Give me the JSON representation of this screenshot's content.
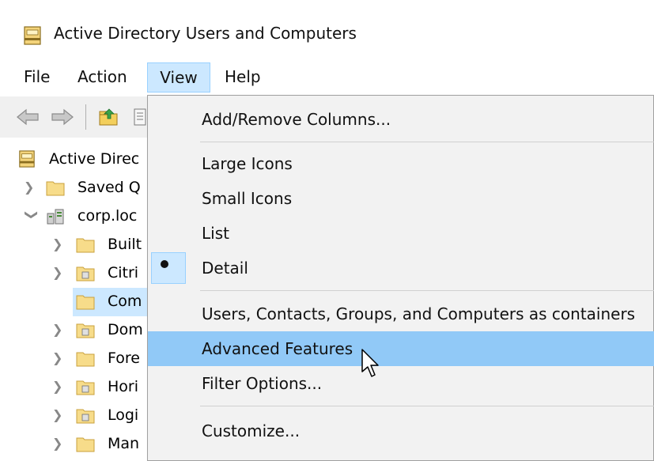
{
  "window": {
    "title": "Active Directory Users and Computers"
  },
  "menubar": {
    "items": [
      {
        "label": "File"
      },
      {
        "label": "Action"
      },
      {
        "label": "View"
      },
      {
        "label": "Help"
      }
    ],
    "active": "View"
  },
  "toolbar": {
    "icons": [
      "back-arrow-icon",
      "forward-arrow-icon",
      "up-folder-icon",
      "properties-icon"
    ]
  },
  "tree": {
    "items": [
      {
        "label": "Active Direc",
        "expander": "none",
        "icon": "ad-root-icon"
      },
      {
        "label": "Saved Q",
        "expander": "collapsed",
        "icon": "folder-icon"
      },
      {
        "label": "corp.loc",
        "expander": "expanded",
        "icon": "domain-icon"
      },
      {
        "label": "Built",
        "expander": "collapsed",
        "icon": "folder-icon"
      },
      {
        "label": "Citri",
        "expander": "collapsed",
        "icon": "ou-folder-icon"
      },
      {
        "label": "Com",
        "expander": "none",
        "icon": "folder-icon",
        "selected": true
      },
      {
        "label": "Dom",
        "expander": "collapsed",
        "icon": "ou-folder-icon"
      },
      {
        "label": "Fore",
        "expander": "collapsed",
        "icon": "folder-icon"
      },
      {
        "label": "Hori",
        "expander": "collapsed",
        "icon": "ou-folder-icon"
      },
      {
        "label": "Logi",
        "expander": "collapsed",
        "icon": "ou-folder-icon"
      },
      {
        "label": "Man",
        "expander": "collapsed",
        "icon": "folder-icon"
      }
    ]
  },
  "view_menu": {
    "items": [
      {
        "label": "Add/Remove Columns..."
      },
      {
        "label": "Large Icons"
      },
      {
        "label": "Small Icons"
      },
      {
        "label": "List"
      },
      {
        "label": "Detail",
        "checked": true
      },
      {
        "label": "Users, Contacts, Groups, and Computers as containers"
      },
      {
        "label": "Advanced Features",
        "highlighted": true
      },
      {
        "label": "Filter Options..."
      },
      {
        "label": "Customize..."
      }
    ]
  },
  "colors": {
    "menu_active_bg": "#cce8ff",
    "menu_highlight_bg": "#91c9f7",
    "folder_yellow": "#f5d67a"
  }
}
